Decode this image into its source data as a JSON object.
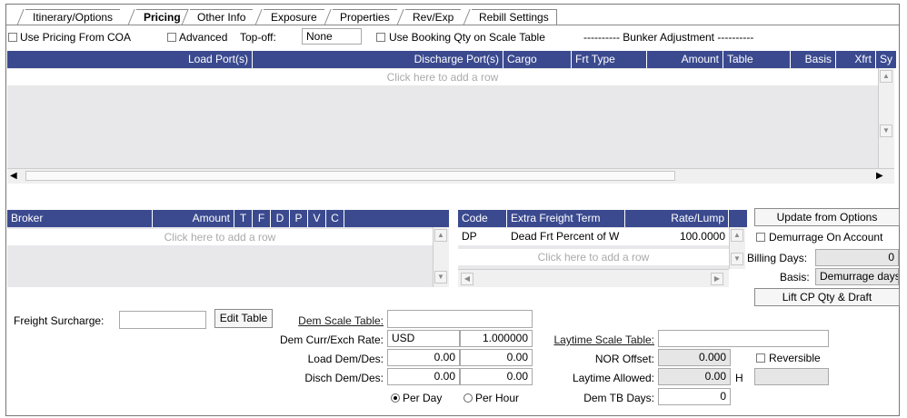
{
  "tabs": [
    "Itinerary/Options",
    "Pricing",
    "Other Info",
    "Exposure",
    "Properties",
    "Rev/Exp",
    "Rebill Settings"
  ],
  "options": {
    "use_pricing_from_coa": "Use Pricing From COA",
    "advanced": "Advanced",
    "top_off_label": "Top-off:",
    "top_off_value": "None",
    "use_booking_qty": "Use Booking Qty on Scale Table",
    "bunker_adjustment": "----------  Bunker Adjustment  ----------"
  },
  "pricing_grid": {
    "columns": [
      "Load Port(s)",
      "Discharge Port(s)",
      "Cargo",
      "Frt Type",
      "Amount",
      "Table",
      "Basis",
      "Xfrt",
      "Sy"
    ],
    "add_row": "Click here to add a row"
  },
  "broker_grid": {
    "columns": [
      "Broker",
      "Amount",
      "T",
      "F",
      "D",
      "P",
      "V",
      "C"
    ],
    "add_row": "Click here to add a row"
  },
  "extra_freight_grid": {
    "columns": [
      "Code",
      "Extra Freight Term",
      "Rate/Lump"
    ],
    "rows": [
      {
        "code": "DP",
        "term": "Dead Frt Percent of W",
        "rate": "100.0000"
      }
    ],
    "add_row": "Click here to add a row"
  },
  "right_panel": {
    "update_button": "Update from Options",
    "demurrage_on_account": "Demurrage On Account",
    "billing_days_label": "Billing Days:",
    "billing_days_value": "0",
    "basis_label": "Basis:",
    "basis_value": "Demurrage days",
    "lift_button": "Lift CP Qty & Draft"
  },
  "bottom": {
    "freight_surcharge_label": "Freight Surcharge:",
    "freight_surcharge_value": "",
    "edit_table_button": "Edit Table",
    "dem_scale_table_label": "Dem Scale Table:",
    "dem_scale_table_value": "",
    "dem_curr_label": "Dem Curr/Exch Rate:",
    "dem_curr_value": "USD",
    "dem_exch_value": "1.000000",
    "load_dem_label": "Load Dem/Des:",
    "load_dem_value": "0.00",
    "load_des_value": "0.00",
    "disch_dem_label": "Disch Dem/Des:",
    "disch_dem_value": "0.00",
    "disch_des_value": "0.00",
    "per_day": "Per Day",
    "per_hour": "Per Hour",
    "laytime_scale_label": "Laytime Scale Table:",
    "laytime_scale_value": "",
    "nor_offset_label": "NOR Offset:",
    "nor_offset_value": "0.000",
    "reversible": "Reversible",
    "laytime_allowed_label": "Laytime Allowed:",
    "laytime_allowed_value": "0.00",
    "laytime_unit": "H",
    "laytime_extra_value": "",
    "dem_tb_days_label": "Dem TB Days:",
    "dem_tb_days_value": "0"
  }
}
